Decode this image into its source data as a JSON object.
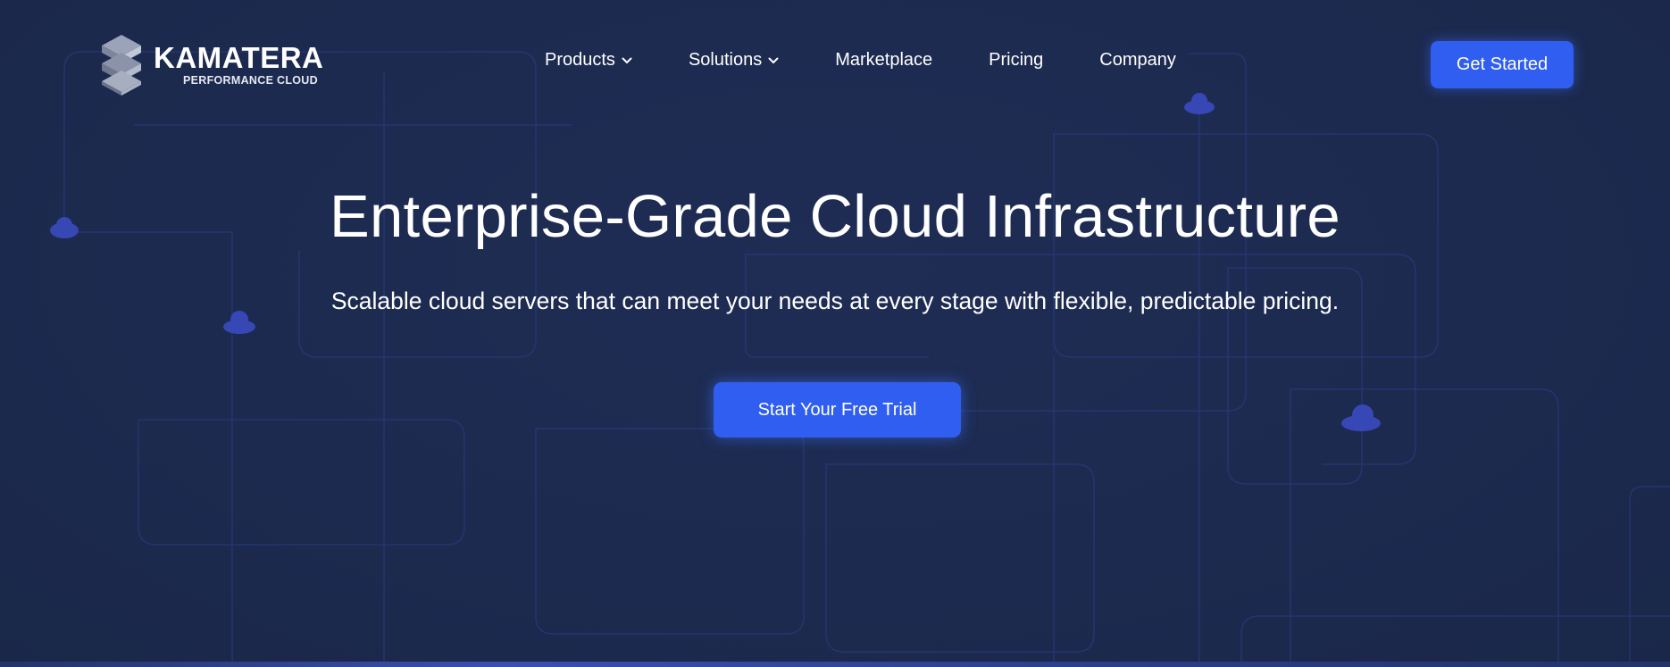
{
  "brand": {
    "name": "KAMATERA",
    "tagline": "PERFORMANCE CLOUD",
    "logo_icon": "stacked-cube-logo-icon"
  },
  "nav": {
    "items": [
      {
        "label": "Products",
        "has_dropdown": true
      },
      {
        "label": "Solutions",
        "has_dropdown": true
      },
      {
        "label": "Marketplace",
        "has_dropdown": false
      },
      {
        "label": "Pricing",
        "has_dropdown": false
      },
      {
        "label": "Company",
        "has_dropdown": false
      }
    ],
    "cta_label": "Get Started"
  },
  "hero": {
    "title": "Enterprise-Grade Cloud Infrastructure",
    "subtitle": "Scalable cloud servers that can meet your needs at every stage with flexible, predictable pricing.",
    "cta_label": "Start Your Free Trial"
  },
  "colors": {
    "background": "#1c2a4f",
    "accent": "#2f5ef0",
    "line": "#2c3f8a",
    "cloud_icon": "#3a4bc0"
  }
}
